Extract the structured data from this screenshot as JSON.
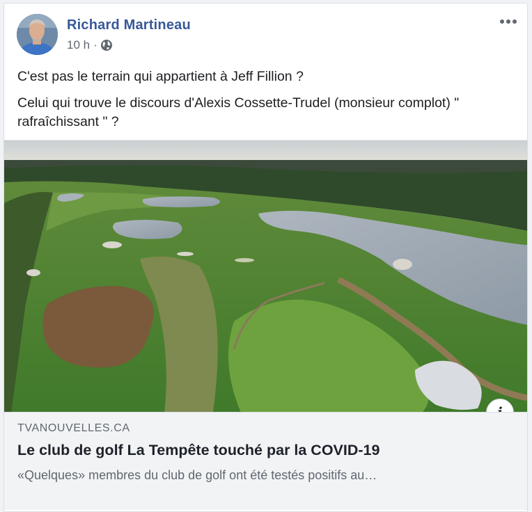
{
  "post": {
    "author": "Richard Martineau",
    "time": "10 h",
    "separator": "·",
    "privacy_icon": "globe-icon",
    "more_icon": "more-options-icon",
    "paragraphs": [
      "C'est pas le terrain qui appartient à Jeff Fillion ?",
      "Celui qui trouve le discours d'Alexis Cossette-Trudel (monsieur complot) \" rafraîchissant \" ?"
    ]
  },
  "link": {
    "domain": "TVANOUVELLES.CA",
    "title": "Le club de golf La Tempête touché par la COVID-19",
    "description": "«Quelques» membres du club de golf ont été testés positifs au…",
    "info_label": "i"
  },
  "colors": {
    "author_link": "#385898",
    "text": "#1c1e21",
    "secondary": "#616770",
    "link_box_bg": "#f2f3f5"
  }
}
